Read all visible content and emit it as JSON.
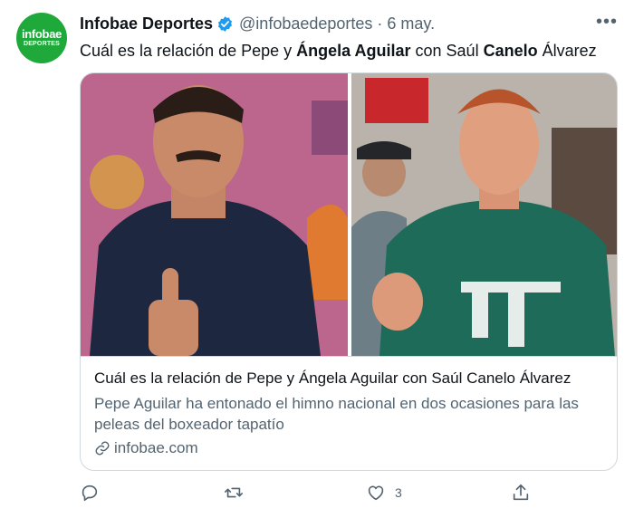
{
  "tweet": {
    "avatar": {
      "line1": "infobae",
      "line2": "DEPORTES",
      "color": "#1ea93a"
    },
    "display_name": "Infobae Deportes",
    "handle": "@infobaedeportes",
    "separator": "·",
    "date": "6 may.",
    "more_icon": "more-icon",
    "text": {
      "part1": "Cuál es la relación de Pepe y ",
      "bold1": "Ángela Aguilar",
      "part2": " con Saúl ",
      "bold2": "Canelo",
      "part3": " Álvarez"
    },
    "card": {
      "title": "Cuál es la relación de Pepe y Ángela Aguilar con Saúl Canelo Álvarez",
      "description": "Pepe Aguilar ha entonado el himno nacional en dos ocasiones para las peleas del boxeador tapatío",
      "link": "infobae.com"
    },
    "actions": {
      "reply_icon": "reply-icon",
      "retweet_icon": "retweet-icon",
      "like_icon": "like-icon",
      "like_count": "3",
      "share_icon": "share-icon"
    },
    "colors": {
      "text": "#0f1419",
      "secondary": "#536471",
      "verified": "#1d9bf0",
      "border": "#cfd9de"
    }
  }
}
